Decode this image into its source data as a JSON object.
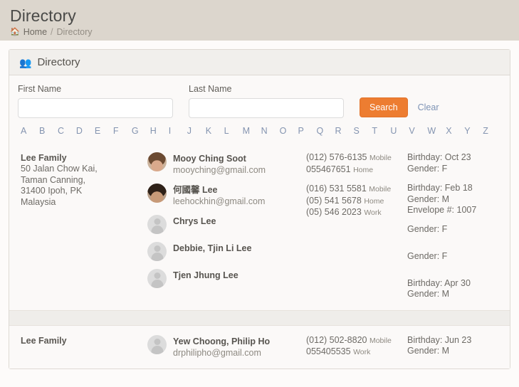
{
  "page": {
    "title": "Directory",
    "breadcrumb": {
      "home_icon": "home-icon",
      "home_label": "Home",
      "separator": "/",
      "current": "Directory"
    }
  },
  "panel": {
    "icon": "group-icon",
    "title": "Directory"
  },
  "search": {
    "first_name_label": "First Name",
    "first_name_value": "",
    "first_name_placeholder": "",
    "last_name_label": "Last Name",
    "last_name_value": "",
    "last_name_placeholder": "",
    "search_button": "Search",
    "clear_link": "Clear",
    "button_color": "#ed7d31"
  },
  "alphabet": [
    "A",
    "B",
    "C",
    "D",
    "E",
    "F",
    "G",
    "H",
    "I",
    "J",
    "K",
    "L",
    "M",
    "N",
    "O",
    "P",
    "Q",
    "R",
    "S",
    "T",
    "U",
    "V",
    "W",
    "X",
    "Y",
    "Z"
  ],
  "families": [
    {
      "name": "Lee Family",
      "address": [
        "50 Jalan Chow Kai,",
        "Taman Canning,",
        "31400 Ipoh, PK",
        "Malaysia"
      ],
      "members": [
        {
          "avatar": "photo",
          "name": "Mooy Ching Soot",
          "email": "mooyching@gmail.com",
          "phones": [
            {
              "number": "(012) 576-6135",
              "type": "Mobile"
            },
            {
              "number": "055467651",
              "type": "Home"
            }
          ],
          "details": [
            "Birthday: Oct 23",
            "Gender: F"
          ]
        },
        {
          "avatar": "photo",
          "name": "何國馨 Lee",
          "email": "leehockhin@gmail.com",
          "phones": [
            {
              "number": "(016) 531 5581",
              "type": "Mobile"
            },
            {
              "number": "(05) 541 5678",
              "type": "Home"
            },
            {
              "number": "(05) 546 2023",
              "type": "Work"
            }
          ],
          "details": [
            "Birthday: Feb 18",
            "Gender: M",
            "Envelope #: 1007"
          ]
        },
        {
          "avatar": "placeholder",
          "name": "Chrys Lee",
          "email": "",
          "phones": [],
          "details": [
            "Gender: F"
          ]
        },
        {
          "avatar": "placeholder",
          "name": "Debbie, Tjin Li Lee",
          "email": "",
          "phones": [],
          "details": [
            "Gender: F"
          ]
        },
        {
          "avatar": "placeholder",
          "name": "Tjen Jhung Lee",
          "email": "",
          "phones": [],
          "details": [
            "Birthday: Apr 30",
            "Gender: M"
          ]
        }
      ]
    },
    {
      "name": "Lee Family",
      "address": [],
      "members": [
        {
          "avatar": "placeholder",
          "name": "Yew Choong, Philip Ho",
          "email": "drphilipho@gmail.com",
          "phones": [
            {
              "number": "(012) 502-8820",
              "type": "Mobile"
            },
            {
              "number": "055405535",
              "type": "Work"
            }
          ],
          "details": [
            "Birthday: Jun 23",
            "Gender: M"
          ]
        }
      ]
    }
  ]
}
